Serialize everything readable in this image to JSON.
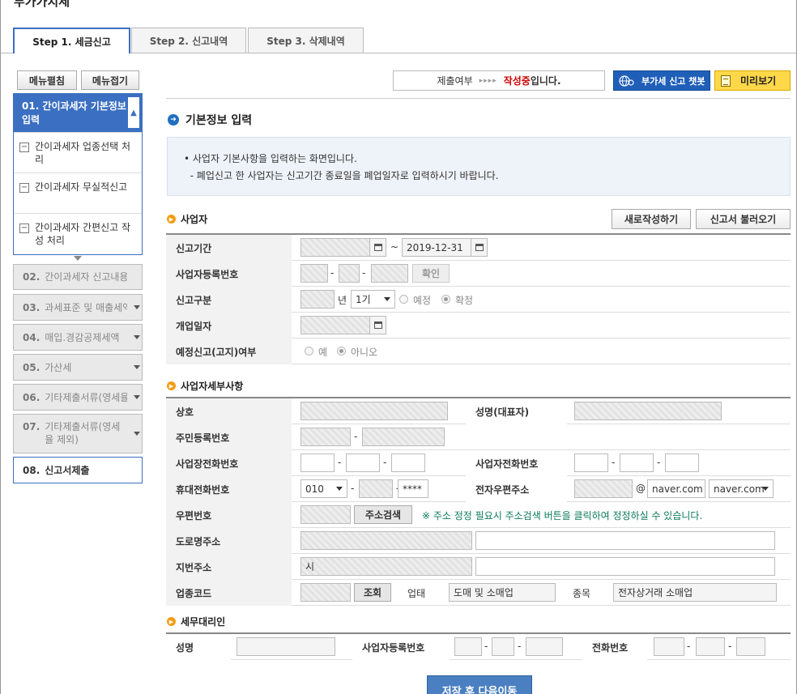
{
  "page": {
    "title": "부가가치세"
  },
  "tabs": [
    {
      "label": "Step 1. 세금신고",
      "active": true
    },
    {
      "label": "Step 2. 신고내역",
      "active": false
    },
    {
      "label": "Step 3. 삭제내역",
      "active": false
    }
  ],
  "menu": {
    "expand_label": "메뉴펼침",
    "collapse_label": "메뉴접기",
    "active_section": {
      "label": "01. 간이과세자 기본정보 입력",
      "sub_items": [
        "간이과세자 업종선택 처리",
        "간이과세자 무실적신고",
        "간이과세자 간편신고 작성 처리"
      ]
    },
    "items": [
      {
        "num": "02.",
        "label": "간이과세자 신고내용"
      },
      {
        "num": "03.",
        "label": "과세표준 및 매출세액"
      },
      {
        "num": "04.",
        "label": "매입.경감공제세액"
      },
      {
        "num": "05.",
        "label": "가산세"
      },
      {
        "num": "06.",
        "label": "기타제출서류(영세율"
      },
      {
        "num": "07.",
        "label": "기타제출서류(영세율 제외)"
      },
      {
        "num": "08.",
        "label": "신고서제출"
      }
    ]
  },
  "status_bar": {
    "label": "제출여부",
    "arrows": "▸▸▸▸",
    "status": "작성중",
    "suffix": "입니다.",
    "chatbot_label": "부가세 신고 챗봇",
    "preview_label": "미리보기"
  },
  "section": {
    "title": "기본정보 입력",
    "info_lines": [
      "• 사업자 기본사항을 입력하는 화면입니다.",
      "  - 폐업신고 한 사업자는 신고기간 종료일을 폐업일자로 입력하시기 바랍니다."
    ]
  },
  "business": {
    "heading": "사업자",
    "new_button": "새로작성하기",
    "load_button": "신고서 불러오기",
    "period_label": "신고기간",
    "period_tilde": "~",
    "period_end": "2019-12-31",
    "reg_label": "사업자등록번호",
    "confirm_button": "확인",
    "type_label": "신고구분",
    "year_unit": "년",
    "term_value": "1기",
    "option_prelim": "예정",
    "option_final": "확정",
    "open_label": "개업일자",
    "prelim_notice_label": "예정신고(고지)여부",
    "option_yes": "예",
    "option_no": "아니오"
  },
  "details": {
    "heading": "사업자세부사항",
    "trade_name_label": "상호",
    "rep_name_label": "성명(대표자)",
    "rrn_label": "주민등록번호",
    "biz_phone_label": "사업장전화번호",
    "owner_phone_label": "사업자전화번호",
    "mobile_label": "휴대전화번호",
    "mobile_prefix": "010",
    "mobile_last": "****",
    "email_label": "전자우편주소",
    "email_at": "@",
    "email_domain": "naver.com",
    "email_domain_select": "naver.com",
    "postal_label": "우편번호",
    "address_search_button": "주소검색",
    "address_notice": "※ 주소 정정 필요시 주소검색 버튼을 클릭하여 정정하실 수 있습니다.",
    "road_address_label": "도로명주소",
    "lot_address_label": "지번주소",
    "lot_address_prefix": "시",
    "industry_code_label": "업종코드",
    "lookup_button": "조회",
    "business_type_label": "업태",
    "business_type_value": "도매 및 소매업",
    "item_label": "종목",
    "item_value": "전자상거래 소매업",
    "dash": "-"
  },
  "agent": {
    "heading": "세무대리인",
    "name_label": "성명",
    "reg_label": "사업자등록번호",
    "phone_label": "전화번호"
  },
  "footer": {
    "save_button": "저장 후 다음이동"
  }
}
